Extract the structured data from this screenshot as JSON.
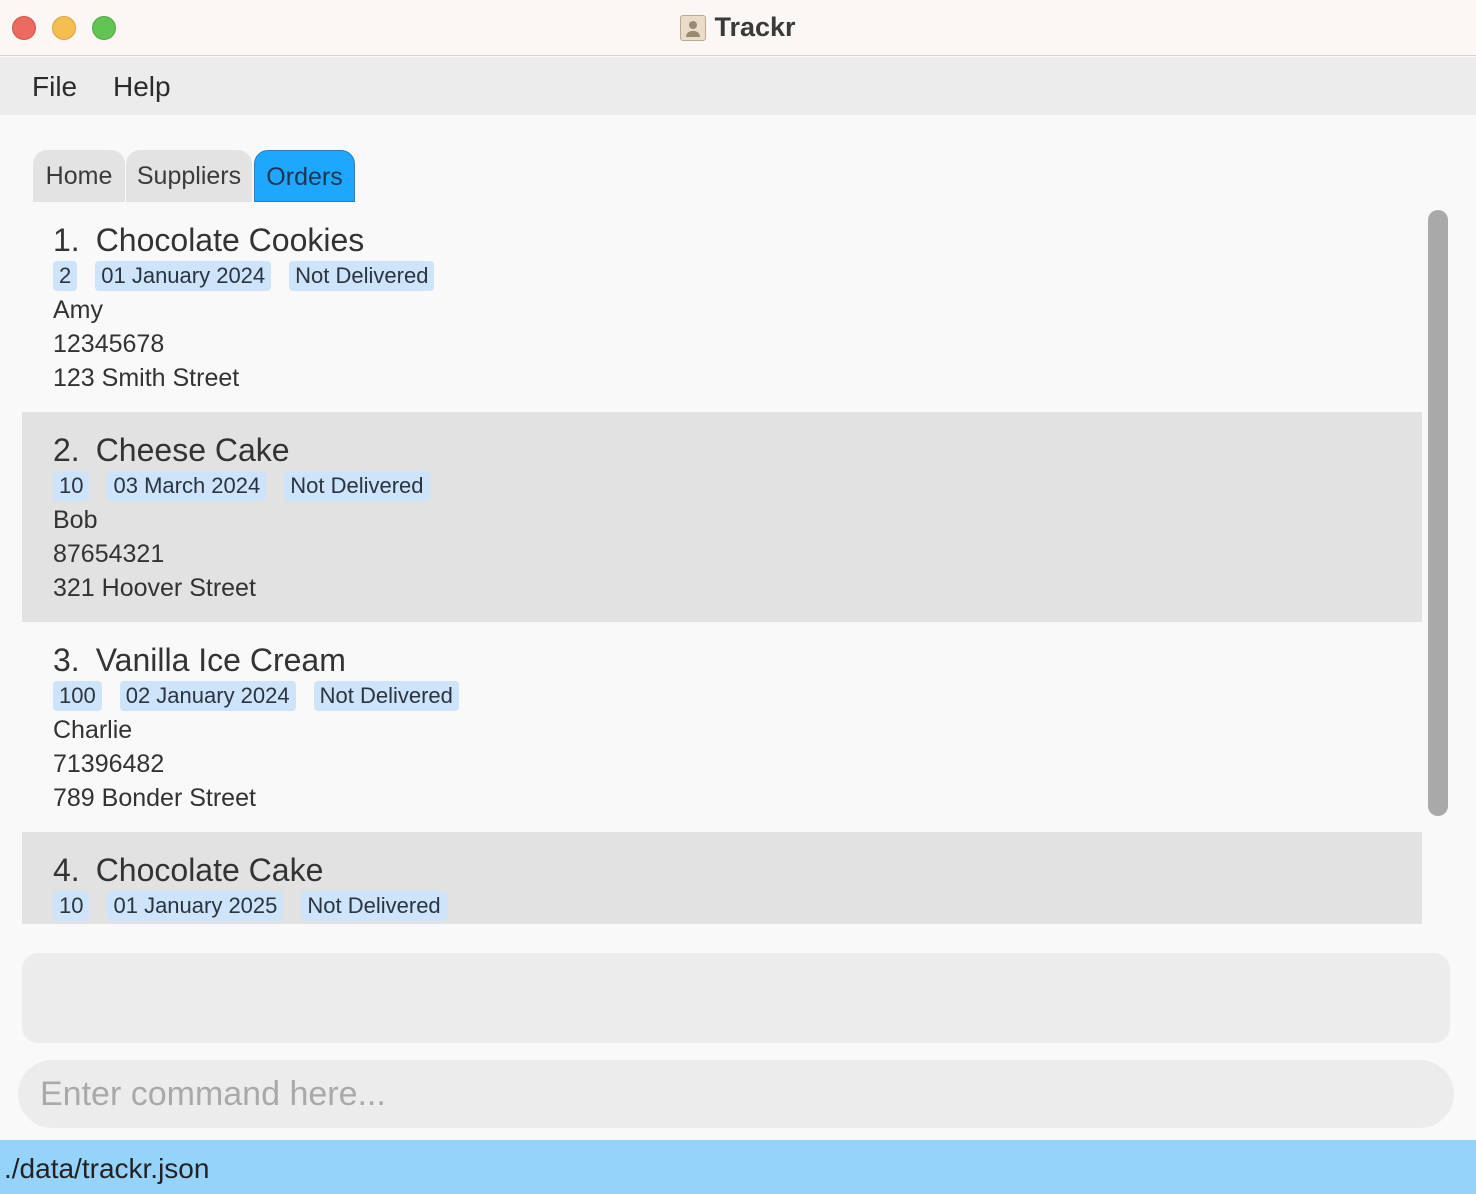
{
  "window": {
    "title": "Trackr"
  },
  "menu": {
    "file": "File",
    "help": "Help"
  },
  "tabs": [
    {
      "label": "Home"
    },
    {
      "label": "Suppliers"
    },
    {
      "label": "Orders"
    }
  ],
  "orders": [
    {
      "index": "1.",
      "name": "Chocolate Cookies",
      "quantity": "2",
      "date": "01 January 2024",
      "status": "Not Delivered",
      "customer": "Amy",
      "phone": "12345678",
      "address": "123 Smith Street"
    },
    {
      "index": "2.",
      "name": "Cheese Cake",
      "quantity": "10",
      "date": "03 March 2024",
      "status": "Not Delivered",
      "customer": "Bob",
      "phone": "87654321",
      "address": "321 Hoover Street"
    },
    {
      "index": "3.",
      "name": "Vanilla Ice Cream",
      "quantity": "100",
      "date": "02 January 2024",
      "status": "Not Delivered",
      "customer": "Charlie",
      "phone": "71396482",
      "address": "789 Bonder Street"
    },
    {
      "index": "4.",
      "name": "Chocolate Cake",
      "quantity": "10",
      "date": "01 January 2025",
      "status": "Not Delivered"
    }
  ],
  "command": {
    "placeholder": "Enter command here...",
    "value": ""
  },
  "result": {
    "text": ""
  },
  "status": {
    "path": "./data/trackr.json"
  },
  "colors": {
    "active_tab": "#1ea7ff",
    "tag_bg": "#cde4fa",
    "status_bar": "#96d3fb"
  }
}
